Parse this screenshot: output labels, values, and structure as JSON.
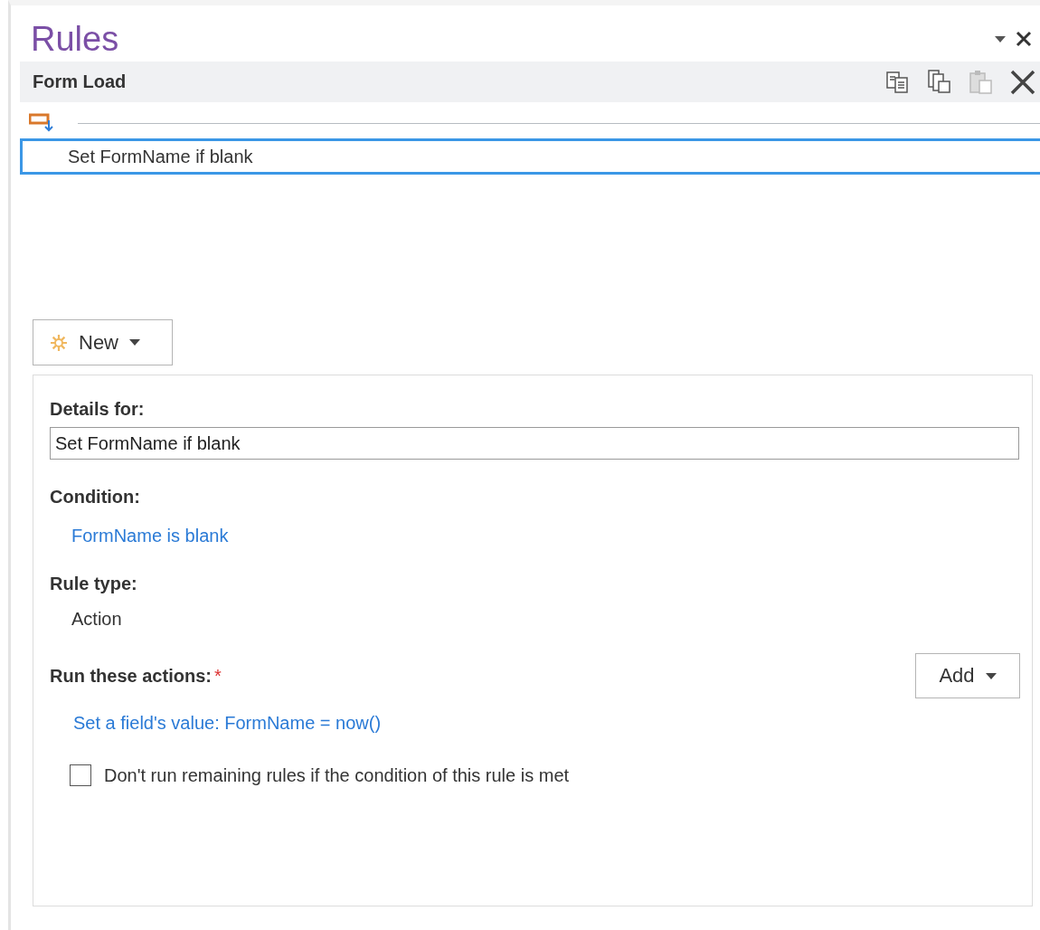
{
  "pane": {
    "title": "Rules"
  },
  "header": {
    "title": "Form Load"
  },
  "rules": [
    {
      "name": "Set FormName if blank",
      "selected": true
    }
  ],
  "new_button": {
    "label": "New"
  },
  "details": {
    "details_label": "Details for:",
    "name_value": "Set FormName if blank",
    "condition_label": "Condition:",
    "condition": "FormName is blank",
    "rule_type_label": "Rule type:",
    "rule_type": "Action",
    "actions_label": "Run these actions:",
    "required_mark": "*",
    "add_button": "Add",
    "actions": [
      "Set a field's value: FormName = now()"
    ],
    "stop_checkbox": {
      "label": "Don't run remaining rules if the condition of this rule is met",
      "checked": false
    }
  }
}
